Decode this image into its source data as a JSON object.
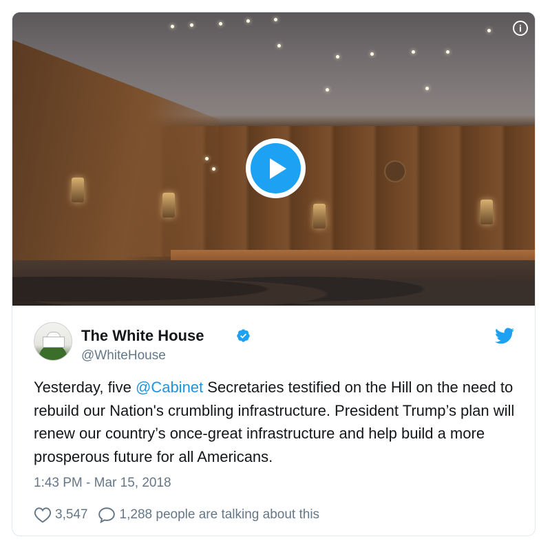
{
  "media": {
    "play_icon": "play-icon",
    "info_icon": "info-icon",
    "info_glyph": "i"
  },
  "author": {
    "name": "The White House",
    "handle": "@WhiteHouse",
    "avatar_icon": "white-house-avatar",
    "verified_icon": "verified-badge-icon"
  },
  "brand": {
    "icon": "twitter-bird-icon",
    "color": "#1da1f2"
  },
  "tweet": {
    "text_before": "Yesterday, five ",
    "mention": "@Cabinet",
    "text_after": " Secretaries testified on the Hill on the need to rebuild our Nation's crumbling infrastructure. President Trump’s plan will renew our country’s once-great infrastructure and help build a more prosperous future for all Americans.",
    "mention_color": "#1b95e0"
  },
  "timestamp": "1:43 PM - Mar 15, 2018",
  "actions": {
    "likes": "3,547",
    "talking": "1,288 people are talking about this",
    "like_icon": "heart-icon",
    "reply_icon": "reply-bubble-icon"
  }
}
